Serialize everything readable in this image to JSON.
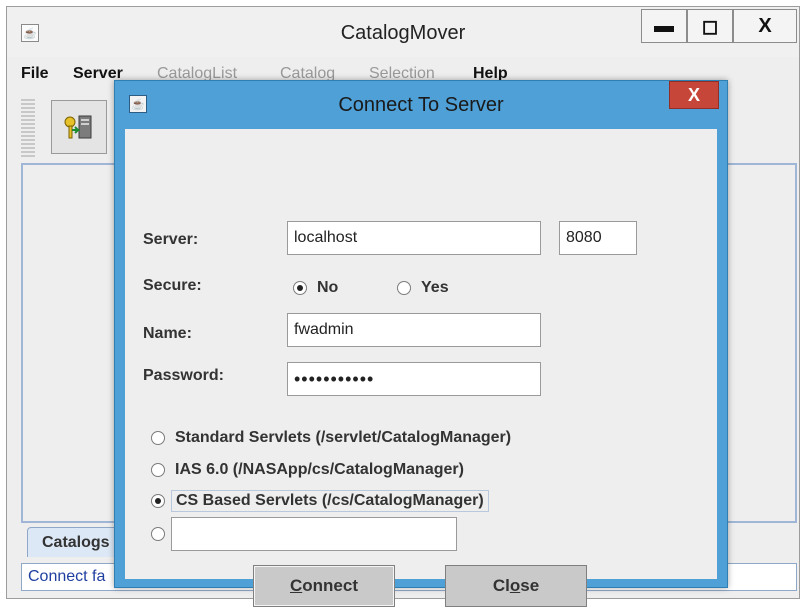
{
  "window": {
    "title": "CatalogMover",
    "controls": {
      "minimize": "▬",
      "maximize": "◻",
      "close": "X"
    }
  },
  "menu": {
    "items": [
      {
        "label": "File",
        "enabled": true
      },
      {
        "label": "Server",
        "enabled": true
      },
      {
        "label": "CatalogList",
        "enabled": false
      },
      {
        "label": "Catalog",
        "enabled": false
      },
      {
        "label": "Selection",
        "enabled": false
      },
      {
        "label": "Help",
        "enabled": true
      }
    ]
  },
  "tabs": {
    "catalogs": "Catalogs"
  },
  "status": {
    "text": "Connect fa"
  },
  "dialog": {
    "title": "Connect To Server",
    "close": "X",
    "labels": {
      "server": "Server:",
      "secure": "Secure:",
      "name": "Name:",
      "password": "Password:"
    },
    "fields": {
      "server": "localhost",
      "port": "8080",
      "name": "fwadmin",
      "password": "•••••••••••",
      "custom_path": ""
    },
    "secure_options": {
      "no": "No",
      "yes": "Yes",
      "selected": "No"
    },
    "servlet_options": [
      {
        "label": "Standard Servlets  (/servlet/CatalogManager)",
        "selected": false
      },
      {
        "label": "IAS 6.0  (/NASApp/cs/CatalogManager)",
        "selected": false
      },
      {
        "label": "CS Based Servlets  (/cs/CatalogManager)",
        "selected": true
      }
    ],
    "buttons": {
      "connect_mnemonic": "C",
      "connect_rest": "onnect",
      "close_pre": "Cl",
      "close_mnemonic": "o",
      "close_post": "se"
    }
  },
  "colors": {
    "dialog_title_bg": "#4ea0d6",
    "close_button_bg": "#c7463a",
    "status_text": "#1f3fa0",
    "panel_border": "#9fb6d6"
  }
}
